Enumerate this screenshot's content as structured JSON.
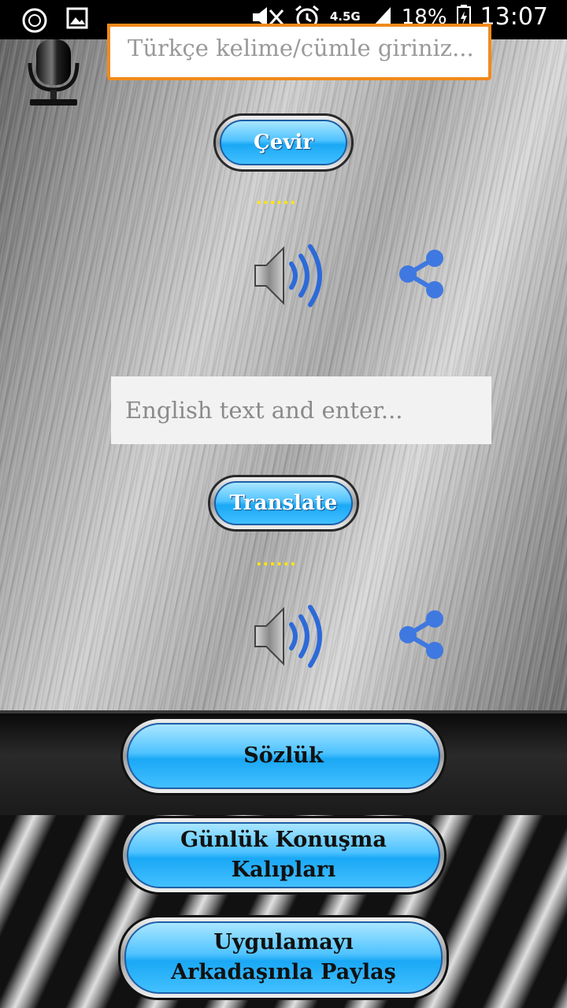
{
  "status_bar": {
    "network": "4.5G",
    "battery_percent": "18%",
    "time": "13:07",
    "icons": [
      "notification-circle-icon",
      "image-icon",
      "mute-icon",
      "alarm-icon",
      "signal-icon",
      "battery-icon"
    ]
  },
  "turkish": {
    "placeholder": "Türkçe kelime/cümle giriniz...",
    "translate_button": "Çevir",
    "result_dots": "......"
  },
  "english": {
    "placeholder": "English text and enter...",
    "translate_button": "Translate",
    "result_dots": "......"
  },
  "menu": {
    "dictionary": "Sözlük",
    "phrases": "Günlük Konuşma Kalıpları",
    "share_app": "Uygulamayı Arkadaşınla Paylaş"
  },
  "colors": {
    "accent_orange": "#f08a1c",
    "button_blue": "#1aa8f5",
    "share_blue": "#3f78e0",
    "dots_yellow": "#ffe600"
  }
}
